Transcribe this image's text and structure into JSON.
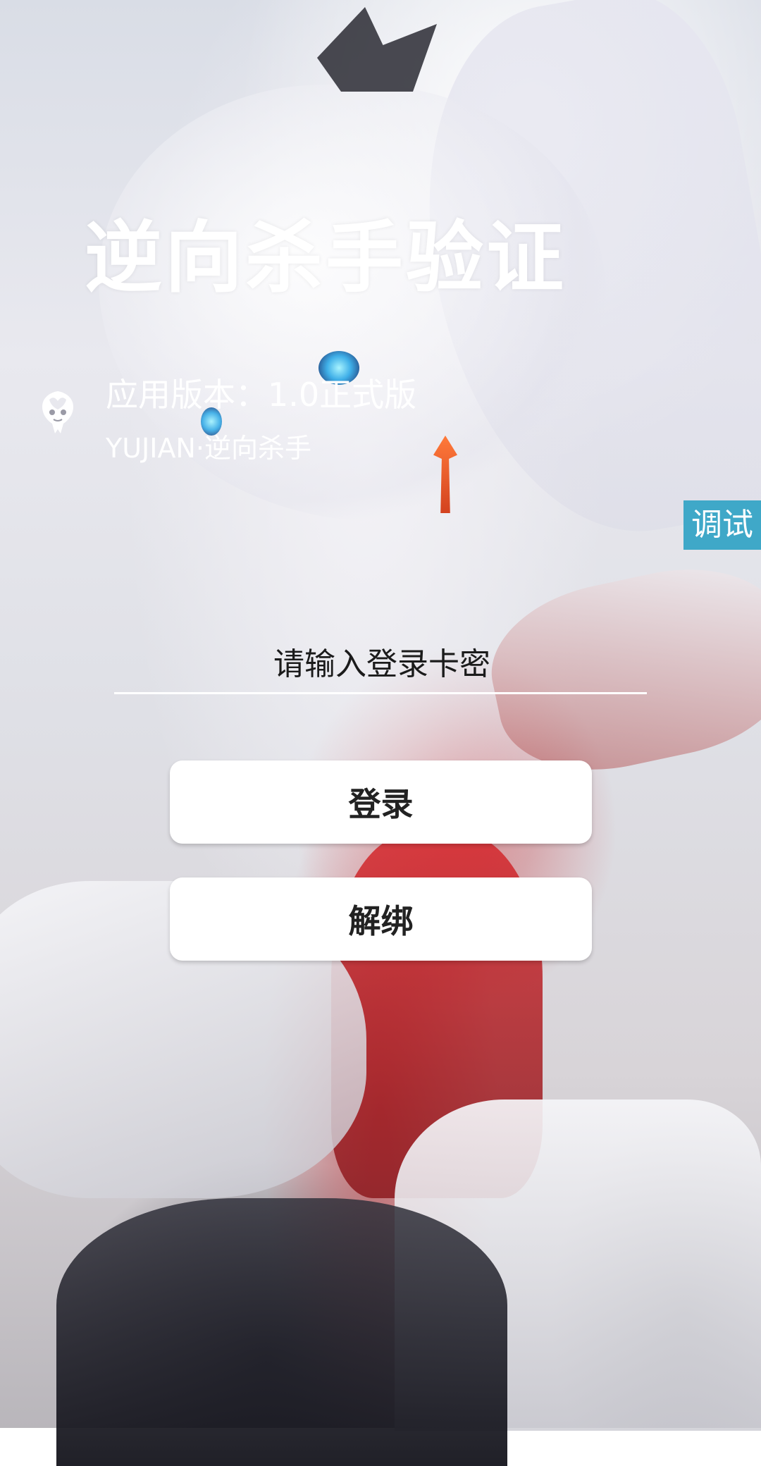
{
  "app": {
    "title": "逆向杀手验证",
    "version_text": "应用版本：1.0正式版",
    "subtitle": "YUJIAN·逆向杀手",
    "logo_icon": "flame-mask-logo-icon"
  },
  "debug": {
    "label": "调试",
    "color": "#3fa8c8"
  },
  "login_form": {
    "card_key_input": {
      "value": "",
      "placeholder": "请输入登录卡密"
    },
    "login_button": "登录",
    "unbind_button": "解绑"
  }
}
